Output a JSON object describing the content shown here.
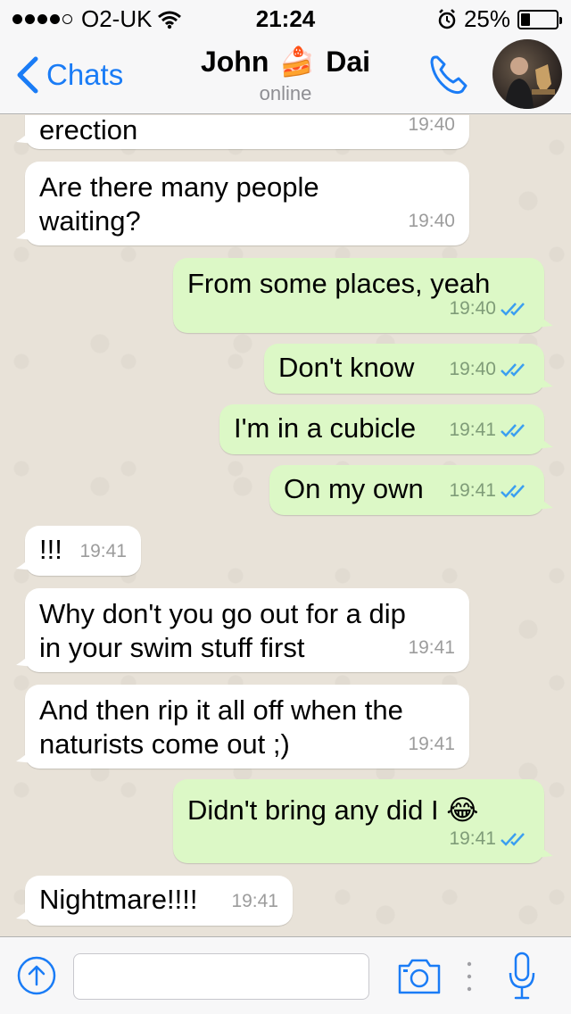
{
  "status_bar": {
    "carrier": "O2-UK",
    "time": "21:24",
    "battery": "25%",
    "battery_level": 0.25
  },
  "nav": {
    "back_label": "Chats",
    "contact_first": "John",
    "contact_last": "Dai",
    "contact_emoji": "🍰",
    "status": "online"
  },
  "messages": [
    {
      "dir": "in",
      "text": "erection",
      "time": "19:40"
    },
    {
      "dir": "in",
      "line1": "Are there many people",
      "line2": "waiting?",
      "time": "19:40"
    },
    {
      "dir": "out",
      "text": "From some places, yeah",
      "time": "19:40"
    },
    {
      "dir": "out",
      "text": "Don't know",
      "time": "19:40"
    },
    {
      "dir": "out",
      "text": "I'm in a cubicle",
      "time": "19:41"
    },
    {
      "dir": "out",
      "text": "On my own",
      "time": "19:41"
    },
    {
      "dir": "in",
      "text": "!!!",
      "time": "19:41"
    },
    {
      "dir": "in",
      "line1": "Why don't you go out for a dip",
      "line2": "in your swim stuff first",
      "time": "19:41"
    },
    {
      "dir": "in",
      "line1": "And then rip it all off when the",
      "line2": "naturists come out ;)",
      "time": "19:41"
    },
    {
      "dir": "out",
      "text": "Didn't bring any did I 😂",
      "time": "19:41"
    },
    {
      "dir": "in",
      "text": "Nightmare!!!!",
      "time": "19:41"
    }
  ],
  "input": {
    "placeholder": ""
  },
  "colors": {
    "accent": "#1a7cf6",
    "outgoing_bubble": "#dcf8c6",
    "incoming_bubble": "#ffffff",
    "read_ticks": "#3b9ff0"
  },
  "icons": {
    "back": "chevron-left-icon",
    "call": "phone-icon",
    "upload": "arrow-up-circle-icon",
    "camera": "camera-icon",
    "mic": "microphone-icon"
  }
}
